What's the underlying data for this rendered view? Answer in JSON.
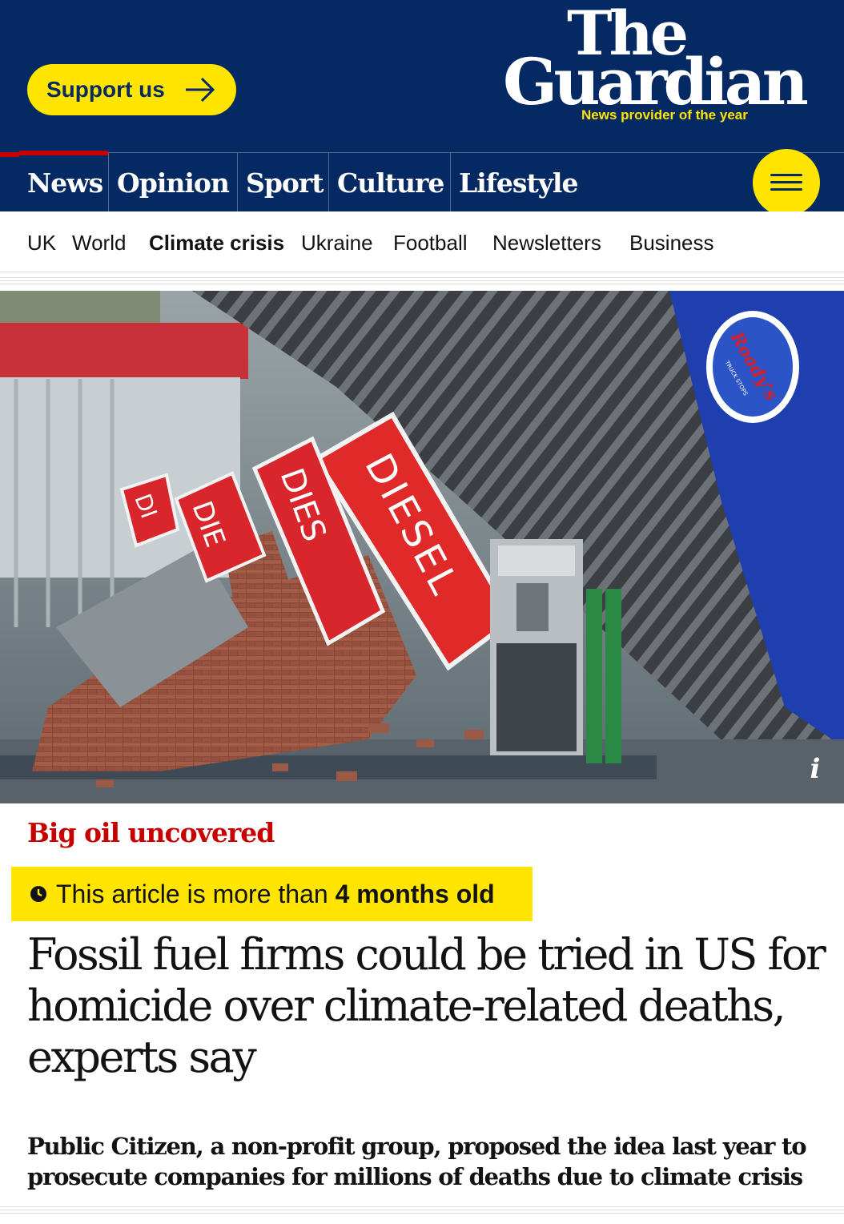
{
  "header": {
    "support_label": "Support us",
    "logo_line1": "The",
    "logo_line2": "Guardian",
    "tagline": "News provider of the year",
    "brand_color": "#052962",
    "accent_color": "#ffe500"
  },
  "pillars": [
    {
      "label": "News"
    },
    {
      "label": "Opinion"
    },
    {
      "label": "Sport"
    },
    {
      "label": "Culture"
    },
    {
      "label": "Lifestyle"
    }
  ],
  "menu_icon": "hamburger-menu-icon",
  "subnav": [
    {
      "label": "UK"
    },
    {
      "label": "World"
    },
    {
      "label": "Climate crisis"
    },
    {
      "label": "Ukraine"
    },
    {
      "label": "Football"
    },
    {
      "label": "Newsletters"
    },
    {
      "label": "Business"
    }
  ],
  "hero": {
    "info_glyph": "i",
    "sign_text_main": "DIESEL",
    "sign_text_2": "DIES",
    "sign_text_3": "DIE",
    "sign_text_4": "DI",
    "brand_sign": "Roady's",
    "brand_sub": "TRUCK STOPS"
  },
  "article": {
    "kicker": "Big oil uncovered",
    "age_prefix": "This article is more than ",
    "age_value": "4 months old",
    "headline": "Fossil fuel firms could be tried in US for homicide over climate-related deaths, experts say",
    "standfirst": "Public Citizen, a non-profit group, proposed the idea last year to prosecute companies for millions of deaths due to climate crisis",
    "kicker_color": "#c70000"
  }
}
